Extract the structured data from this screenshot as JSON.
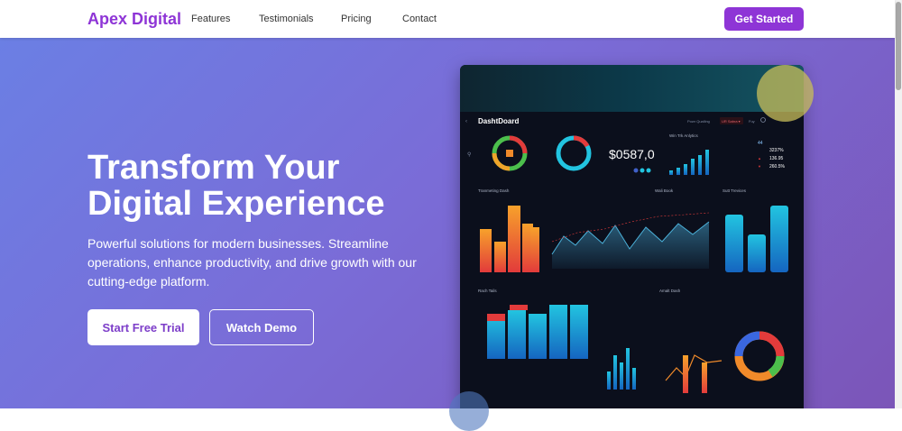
{
  "nav": {
    "brand": "Apex Digital",
    "links": [
      "Features",
      "Testimonials",
      "Pricing",
      "Contact"
    ],
    "cta": "Get Started"
  },
  "hero": {
    "headline_line1": "Transform Your",
    "headline_line2": "Digital Experience",
    "subtext": "Powerful solutions for modern businesses. Streamline operations, enhance productivity, and drive growth with our cutting-edge platform.",
    "primary_button": "Start Free Trial",
    "secondary_button": "Watch Demo"
  },
  "mock_dashboard": {
    "title": "DashtDoard",
    "metric": "$0587,0",
    "panel_labels": {
      "win_analytics": "Win Trk Anlytics",
      "trending": "Tranmeting Dash",
      "wali_book": "Wali Book",
      "sutt_trevices": "Sutt Trevices",
      "rach_tails": "Rach Tails",
      "amalt_dash": "Amalt Dash"
    },
    "stats": [
      "3237%",
      "136.95",
      "260.5%"
    ],
    "colors": {
      "accent": "#8e35d6",
      "cyan": "#22c4e0",
      "orange": "#f08a2a",
      "red": "#e23b3b"
    }
  }
}
